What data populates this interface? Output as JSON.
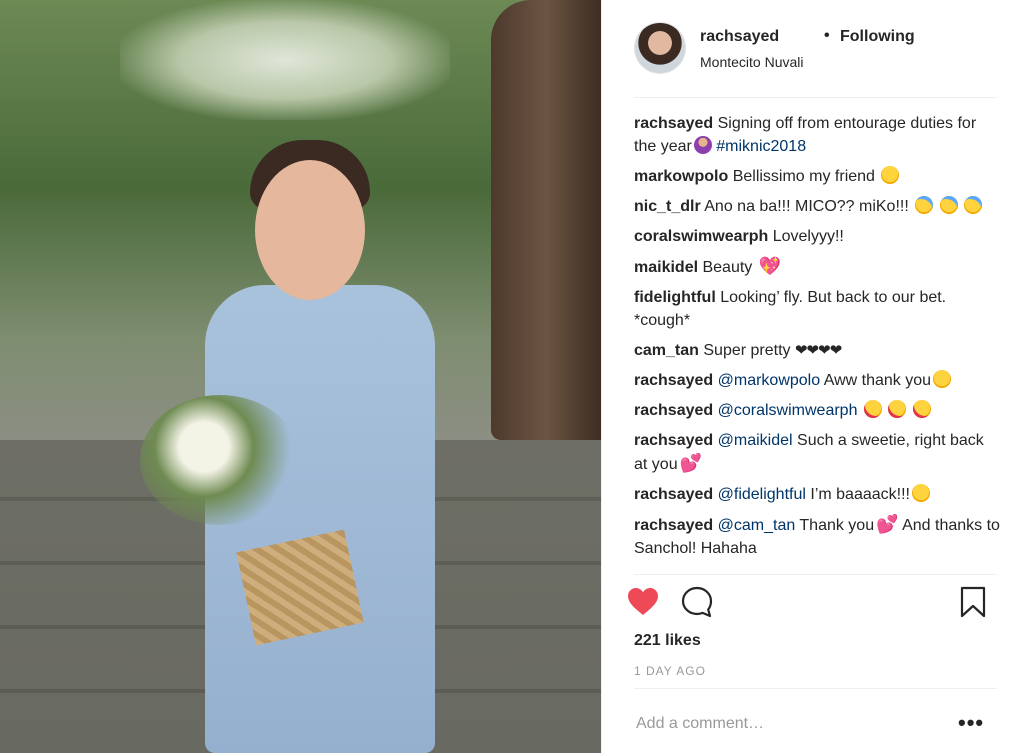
{
  "post": {
    "username": "rachsayed",
    "separator": "•",
    "follow_status": "Following",
    "location": "Montecito Nuvali"
  },
  "comments": [
    {
      "user": "rachsayed",
      "parts": [
        "Signing off from entourage duties for the year",
        " ",
        "#miknic2018"
      ]
    },
    {
      "user": "markowpolo",
      "text": "Bellissimo my friend"
    },
    {
      "user": "nic_t_dlr",
      "text": "Ano na ba!!! MICO?? miKo!!!"
    },
    {
      "user": "coralswimwearph",
      "text": "Lovelyyy!!"
    },
    {
      "user": "maikidel",
      "text": "Beauty"
    },
    {
      "user": "fidelightful",
      "text": "Looking’ fly. But back to our bet. *cough*"
    },
    {
      "user": "cam_tan",
      "text": "Super pretty",
      "hearts": "❤❤❤❤"
    },
    {
      "user": "rachsayed",
      "mention": "@markowpolo",
      "text": "Aww thank you"
    },
    {
      "user": "rachsayed",
      "mention": "@coralswimwearph",
      "text": ""
    },
    {
      "user": "rachsayed",
      "mention": "@maikidel",
      "text": "Such a sweetie, right back at you"
    },
    {
      "user": "rachsayed",
      "mention": "@fidelightful",
      "text": "I’m baaaack!!!"
    },
    {
      "user": "rachsayed",
      "mention": "@cam_tan",
      "text": "Thank you",
      "text2": "And thanks to Sanchol! Hahaha"
    }
  ],
  "likes": "221 likes",
  "timestamp": "1 DAY AGO",
  "add_comment_placeholder": "Add a comment…",
  "more_label": "•••",
  "icons": {
    "like": "heart-icon",
    "comment": "comment-icon",
    "save": "bookmark-icon"
  },
  "colors": {
    "like_red": "#ed4956",
    "link_blue": "#003569",
    "muted": "#999999"
  }
}
